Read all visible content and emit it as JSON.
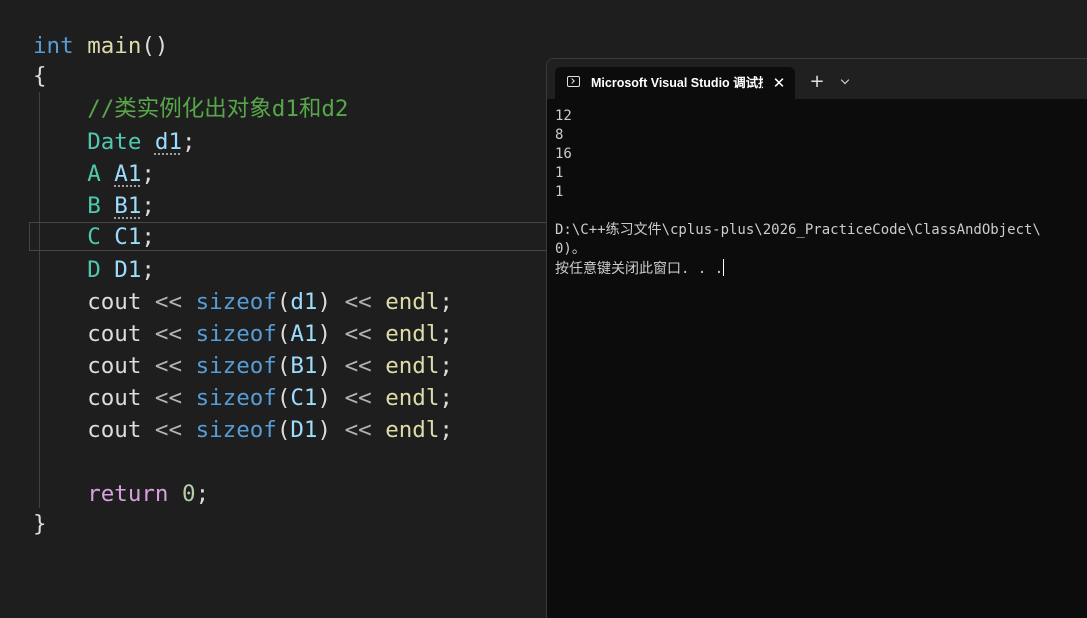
{
  "editor": {
    "lines": [
      {
        "kw": "int",
        "fn": "main",
        "parens": "()"
      },
      {
        "brace": "{"
      },
      {
        "comment": "//类实例化出对象d1和d2"
      },
      {
        "type": "Date",
        "var": "d1",
        "semi": ";"
      },
      {
        "type": "A",
        "var": "A1",
        "semi": ";"
      },
      {
        "type": "B",
        "var": "B1",
        "semi": ";"
      },
      {
        "type": "C",
        "var": "C1",
        "semi": ";"
      },
      {
        "type": "D",
        "var": "D1",
        "semi": ";"
      },
      {
        "cout": "cout",
        "op": "<<",
        "fn": "sizeof",
        "arg": "d1",
        "endl": "endl"
      },
      {
        "cout": "cout",
        "op": "<<",
        "fn": "sizeof",
        "arg": "A1",
        "endl": "endl"
      },
      {
        "cout": "cout",
        "op": "<<",
        "fn": "sizeof",
        "arg": "B1",
        "endl": "endl"
      },
      {
        "cout": "cout",
        "op": "<<",
        "fn": "sizeof",
        "arg": "C1",
        "endl": "endl"
      },
      {
        "cout": "cout",
        "op": "<<",
        "fn": "sizeof",
        "arg": "D1",
        "endl": "endl"
      },
      {
        "ret": "return",
        "num": "0",
        "semi": ";"
      },
      {
        "brace": "}"
      }
    ]
  },
  "console": {
    "tab_title": "Microsoft Visual Studio 调试控制台",
    "close_glyph": "✕",
    "new_tab_glyph": "+",
    "output": [
      "12",
      "8",
      "16",
      "1",
      "1",
      "",
      "D:\\C++练习文件\\cplus-plus\\2026_PracticeCode\\ClassAndObject\\",
      "0)。",
      "按任意键关闭此窗口. . ."
    ]
  }
}
